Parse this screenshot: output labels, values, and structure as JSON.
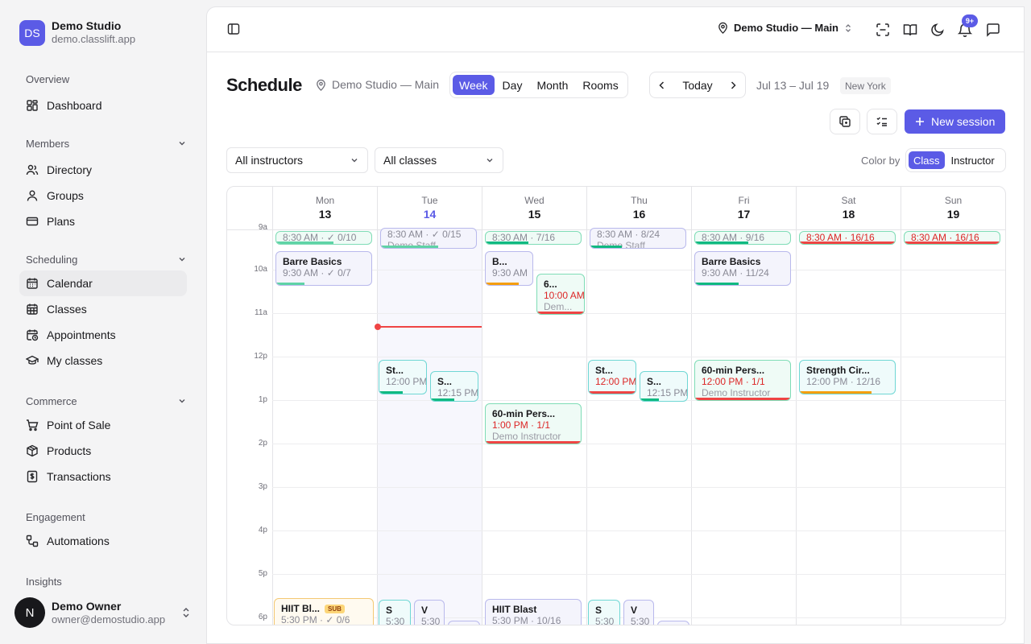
{
  "sidebar": {
    "logo": "DS",
    "studio_name": "Demo Studio",
    "studio_domain": "demo.classlift.app",
    "groups": [
      {
        "label": "Overview",
        "items": [
          {
            "label": "Dashboard"
          }
        ]
      },
      {
        "label": "Members",
        "items": [
          {
            "label": "Directory"
          },
          {
            "label": "Groups"
          },
          {
            "label": "Plans"
          }
        ]
      },
      {
        "label": "Scheduling",
        "items": [
          {
            "label": "Calendar"
          },
          {
            "label": "Classes"
          },
          {
            "label": "Appointments"
          },
          {
            "label": "My classes"
          }
        ]
      },
      {
        "label": "Commerce",
        "items": [
          {
            "label": "Point of Sale"
          },
          {
            "label": "Products"
          },
          {
            "label": "Transactions"
          }
        ]
      },
      {
        "label": "Engagement",
        "items": [
          {
            "label": "Automations"
          }
        ]
      },
      {
        "label": "Insights",
        "items": []
      }
    ],
    "user": {
      "initial": "N",
      "name": "Demo Owner",
      "email": "owner@demostudio.app"
    }
  },
  "topbar": {
    "location": "Demo Studio — Main",
    "notifications_badge": "9+"
  },
  "page": {
    "title": "Schedule",
    "location": "Demo Studio — Main",
    "view_tabs": [
      "Week",
      "Day",
      "Month",
      "Rooms"
    ],
    "active_view": "Week",
    "today_label": "Today",
    "date_range": "Jul 13 – Jul 19",
    "timezone": "New York",
    "new_session_label": "New session",
    "instructor_filter": "All instructors",
    "class_filter": "All classes",
    "color_by_label": "Color by",
    "color_by_options": [
      "Class",
      "Instructor"
    ],
    "color_by_active": "Class"
  },
  "calendar": {
    "days": [
      {
        "name": "Mon",
        "num": "13"
      },
      {
        "name": "Tue",
        "num": "14",
        "today": true
      },
      {
        "name": "Wed",
        "num": "15"
      },
      {
        "name": "Thu",
        "num": "16"
      },
      {
        "name": "Fri",
        "num": "17"
      },
      {
        "name": "Sat",
        "num": "18"
      },
      {
        "name": "Sun",
        "num": "19"
      }
    ],
    "hours": [
      "9a",
      "10a",
      "11a",
      "12p",
      "1p",
      "2p",
      "3p",
      "4p",
      "5p",
      "6p"
    ],
    "events": [
      {
        "day": 0,
        "title": "",
        "sub": "8:30 AM · ✓ 0/10",
        "fill": 0.6,
        "color": "mint",
        "bar": "#5fd3a6"
      },
      {
        "day": 1,
        "title": "",
        "sub": "8:30 AM · ✓ 0/15",
        "info": "Demo Staff",
        "fill": 0.6,
        "color": "purple",
        "bar": "#5fd3a6"
      },
      {
        "day": 2,
        "title": "",
        "sub": "8:30 AM · 7/16",
        "fill": 0.45,
        "color": "mint",
        "bar": "#10b981"
      },
      {
        "day": 3,
        "title": "",
        "sub": "8:30 AM · 8/24",
        "info": "Demo Staff",
        "fill": 0.33,
        "color": "purple",
        "bar": "#10b981"
      },
      {
        "day": 4,
        "title": "",
        "sub": "8:30 AM · 9/16",
        "fill": 0.56,
        "color": "mint",
        "bar": "#10b981"
      },
      {
        "day": 5,
        "title": "",
        "sub": "8:30 AM · 16/16",
        "fill": 1,
        "color": "mint",
        "bar": "#ef4444",
        "red": true
      },
      {
        "day": 6,
        "title": "",
        "sub": "8:30 AM · 16/16",
        "fill": 1,
        "color": "mint",
        "bar": "#ef4444",
        "red": true
      },
      {
        "day": 0,
        "title": "Barre Basics",
        "sub": "9:30 AM · ✓ 0/7",
        "fill": 0.3,
        "color": "purple",
        "bar": "#5fd3a6"
      },
      {
        "day": 2,
        "title": "B...",
        "sub": "9:30 AM",
        "fill": 0.7,
        "color": "purple",
        "bar": "#f59e0b"
      },
      {
        "day": 2,
        "title": "6...",
        "sub": "10:00 AM",
        "info": "Dem...",
        "fill": 1,
        "color": "mint",
        "bar": "#ef4444",
        "red": true
      },
      {
        "day": 4,
        "title": "Barre Basics",
        "sub": "9:30 AM · 11/24",
        "fill": 0.46,
        "color": "purple",
        "bar": "#10b981"
      },
      {
        "day": 1,
        "title": "St...",
        "sub": "12:00 PM",
        "fill": 0.5,
        "color": "cyan",
        "bar": "#10b981"
      },
      {
        "day": 1,
        "title": "S...",
        "sub": "12:15 PM",
        "fill": 0.5,
        "color": "cyan",
        "bar": "#10b981"
      },
      {
        "day": 3,
        "title": "St...",
        "sub": "12:00 PM",
        "fill": 1,
        "color": "cyan",
        "bar": "#ef4444",
        "red": true
      },
      {
        "day": 3,
        "title": "S...",
        "sub": "12:15 PM",
        "fill": 0.4,
        "color": "cyan",
        "bar": "#10b981"
      },
      {
        "day": 4,
        "title": "60-min Pers...",
        "sub": "12:00 PM · 1/1",
        "info": "Demo Instructor",
        "fill": 1,
        "color": "mint",
        "bar": "#ef4444",
        "red": true
      },
      {
        "day": 5,
        "title": "Strength Cir...",
        "sub": "12:00 PM · 12/16",
        "fill": 0.75,
        "color": "cyan",
        "bar": "#f59e0b"
      },
      {
        "day": 2,
        "title": "60-min Pers...",
        "sub": "1:00 PM · 1/1",
        "info": "Demo Instructor",
        "fill": 1,
        "color": "mint",
        "bar": "#ef4444",
        "red": true
      },
      {
        "day": 0,
        "title": "HIIT Bl...",
        "badge": "SUB",
        "sub": "5:30 PM · ✓ 0/6",
        "fill": 0,
        "color": "amber",
        "bar": "#f59e0b"
      },
      {
        "day": 1,
        "title": "S",
        "sub": "5:30",
        "fill": 0,
        "color": "cyan",
        "bar": "#10b981"
      },
      {
        "day": 1,
        "title": "V",
        "sub": "5:30",
        "fill": 0,
        "color": "purple",
        "bar": "#10b981"
      },
      {
        "day": 1,
        "title": "",
        "sub": "",
        "fill": 0,
        "color": "purple",
        "bar": "#10b981"
      },
      {
        "day": 2,
        "title": "HIIT Blast",
        "sub": "5:30 PM · 10/16",
        "fill": 0,
        "color": "purple",
        "bar": "#10b981"
      },
      {
        "day": 3,
        "title": "S",
        "sub": "5:30",
        "fill": 0,
        "color": "cyan",
        "bar": "#10b981"
      },
      {
        "day": 3,
        "title": "V",
        "sub": "5:30",
        "fill": 0,
        "color": "purple",
        "bar": "#10b981"
      },
      {
        "day": 3,
        "title": "",
        "sub": "",
        "fill": 0,
        "color": "purple",
        "bar": "#10b981"
      }
    ]
  },
  "colors": {
    "accent": "#5b5be6",
    "now_line": "#ef4444"
  }
}
